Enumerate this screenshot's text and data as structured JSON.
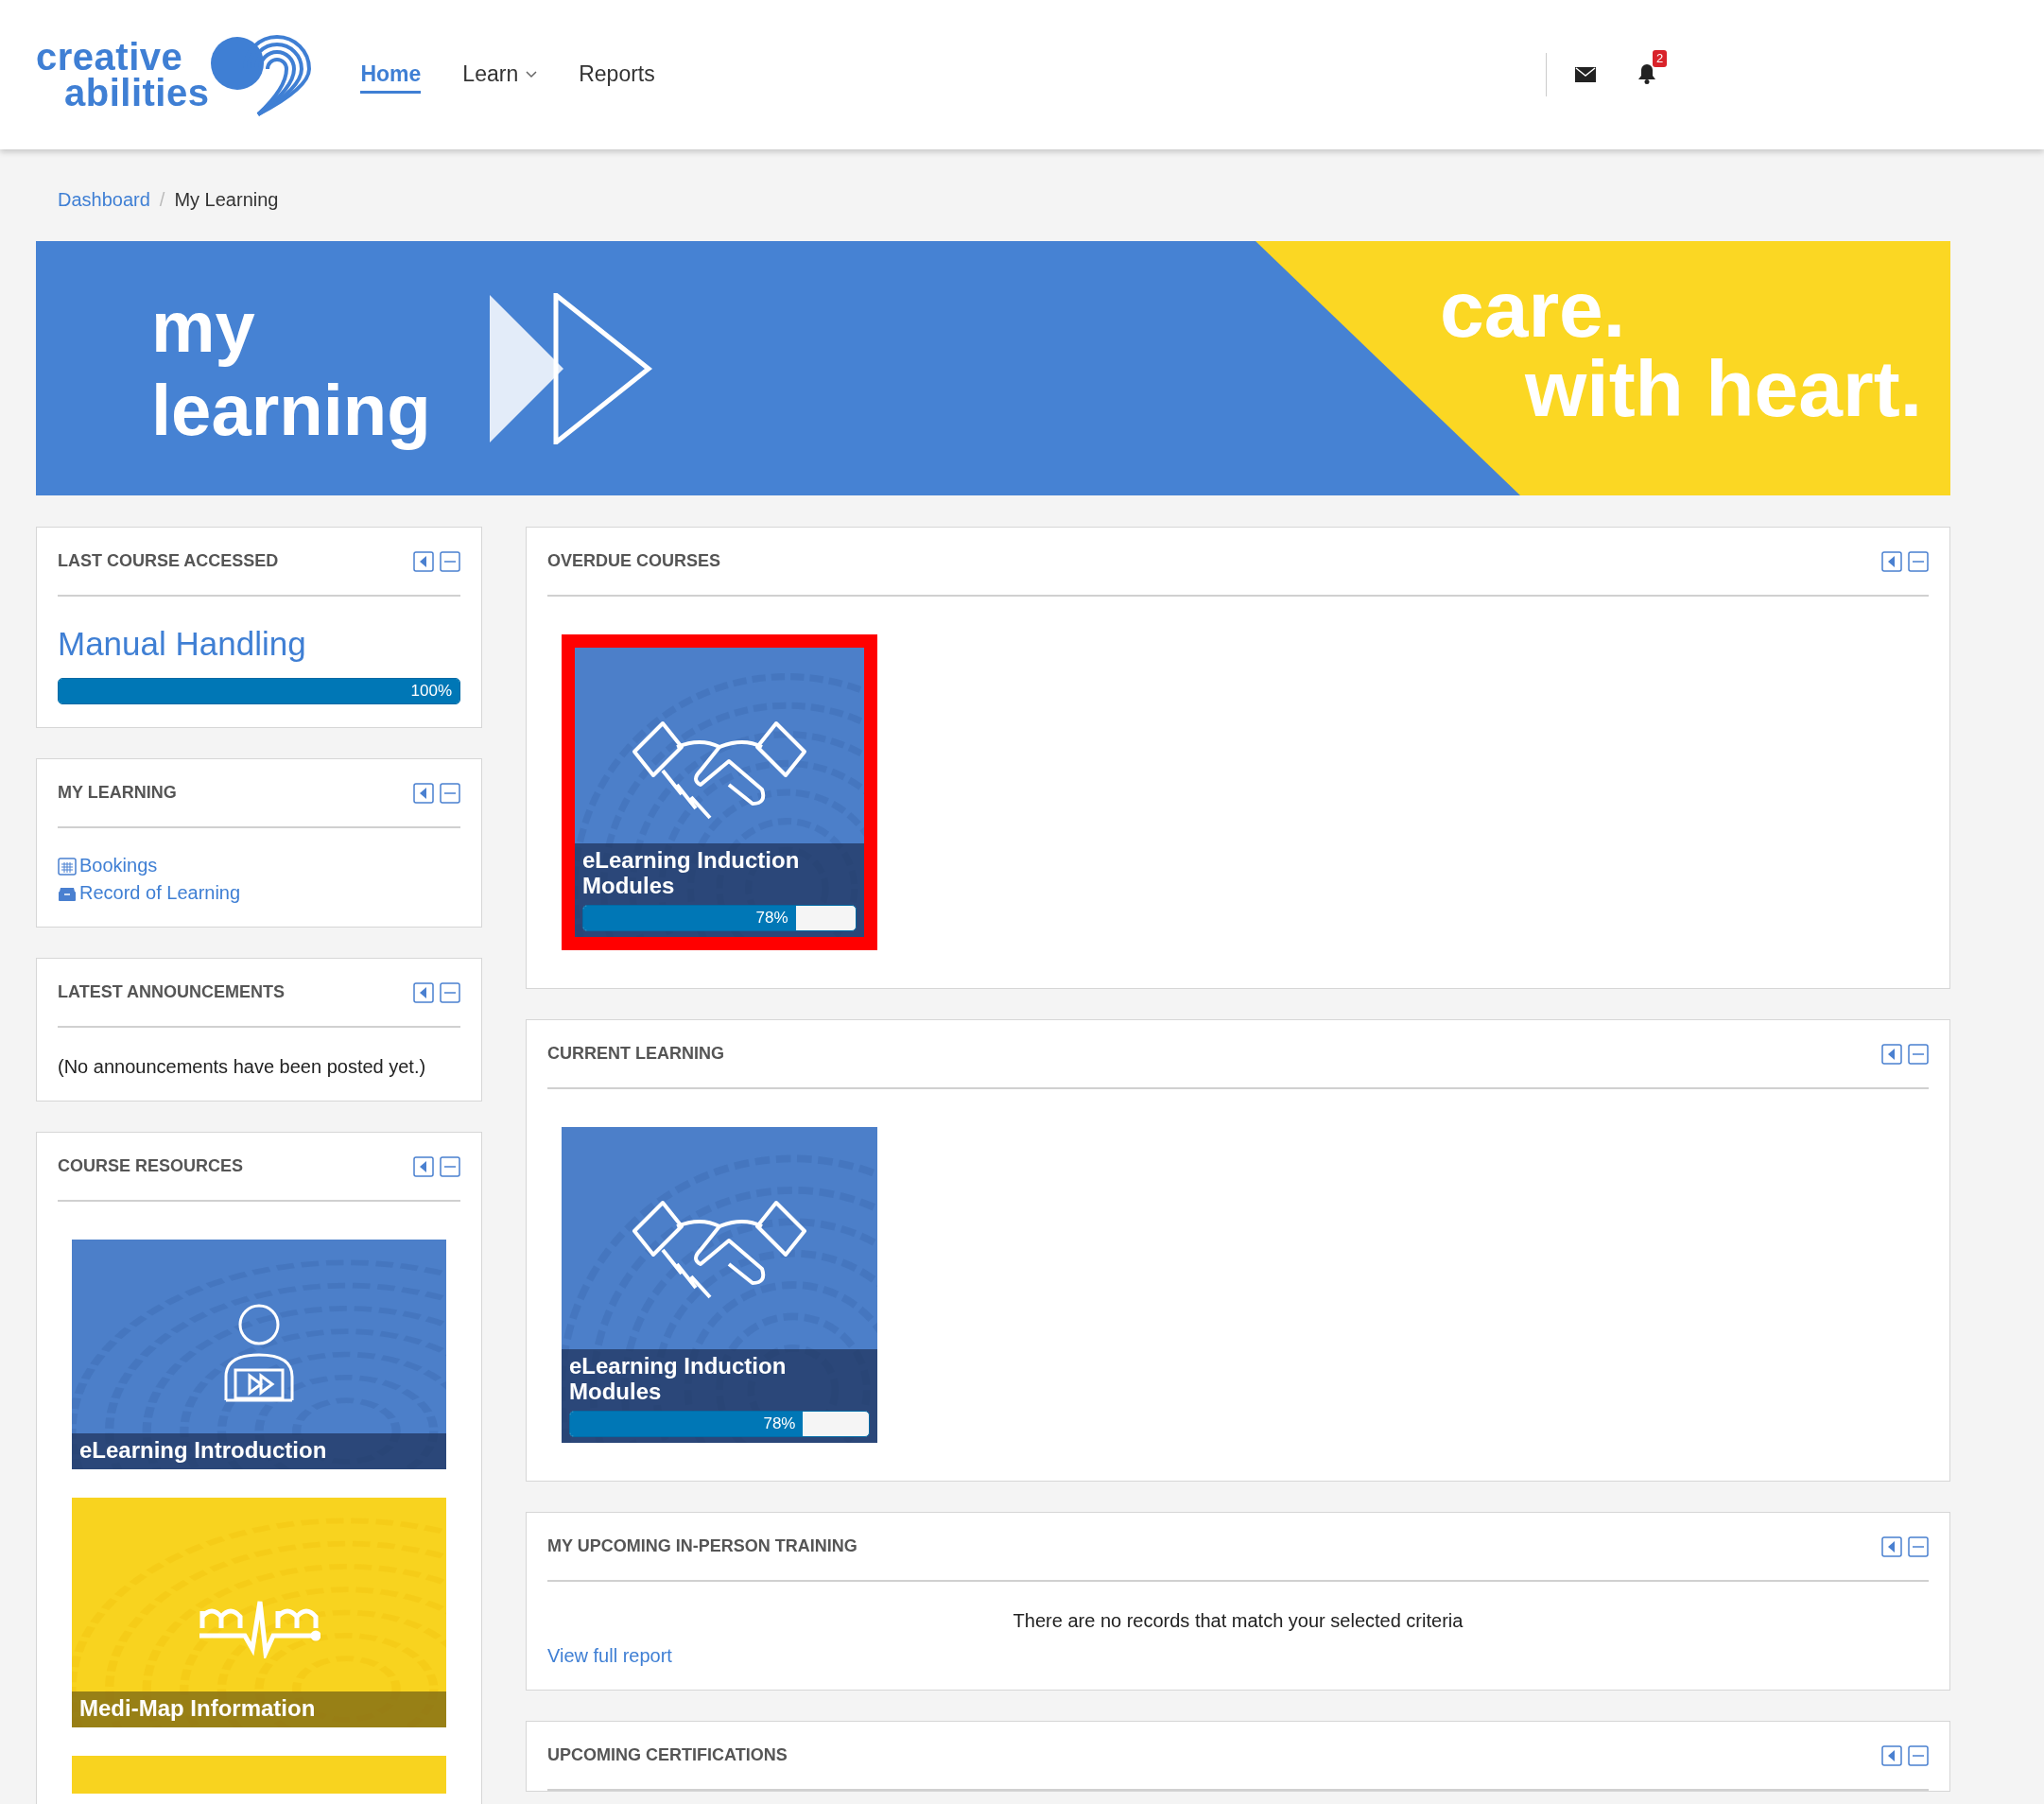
{
  "header": {
    "logo": [
      "creative",
      "abilities"
    ],
    "nav": [
      {
        "label": "Home",
        "selected": true,
        "dropdown": false
      },
      {
        "label": "Learn",
        "selected": false,
        "dropdown": true
      },
      {
        "label": "Reports",
        "selected": false,
        "dropdown": false
      }
    ],
    "notification_count": "2"
  },
  "breadcrumb": {
    "items": [
      "Dashboard",
      "My Learning"
    ],
    "separator": "/"
  },
  "banner": {
    "title_lines": [
      "my",
      "learning"
    ],
    "tagline_lines": [
      "care.",
      "with heart."
    ]
  },
  "left_blocks": [
    {
      "kind": "last_course",
      "title": "LAST COURSE ACCESSED",
      "course": "Manual Handling",
      "level": 1,
      "reading": "100%"
    },
    {
      "kind": "links",
      "title": "MY LEARNING",
      "links": [
        "Bookings",
        "Record of Learning"
      ]
    },
    {
      "kind": "message",
      "title": "LATEST ANNOUNCEMENTS",
      "message": "(No announcements have been posted yet.)"
    },
    {
      "kind": "resources",
      "title": "COURSE RESOURCES",
      "tiles": [
        {
          "title": "eLearning Introduction",
          "color": "#4c7fc9"
        },
        {
          "title": "Medi-Map Information",
          "color": "#f8d31f"
        },
        {
          "color": "#f8d31f"
        }
      ]
    }
  ],
  "right_blocks": [
    {
      "kind": "courses",
      "title": "OVERDUE COURSES",
      "tiles": [
        {
          "title": "eLearning Induction Modules",
          "level": 0.78,
          "reading": "78%",
          "overdue": true
        }
      ]
    },
    {
      "kind": "courses",
      "title": "CURRENT LEARNING",
      "tiles": [
        {
          "title": "eLearning Induction Modules",
          "level": 0.78,
          "reading": "78%",
          "overdue": false
        }
      ]
    },
    {
      "kind": "report",
      "title": "MY UPCOMING IN-PERSON TRAINING",
      "message": "There are no records that match your selected criteria",
      "link": "View full report"
    },
    {
      "kind": "empty",
      "title": "UPCOMING CERTIFICATIONS"
    }
  ]
}
